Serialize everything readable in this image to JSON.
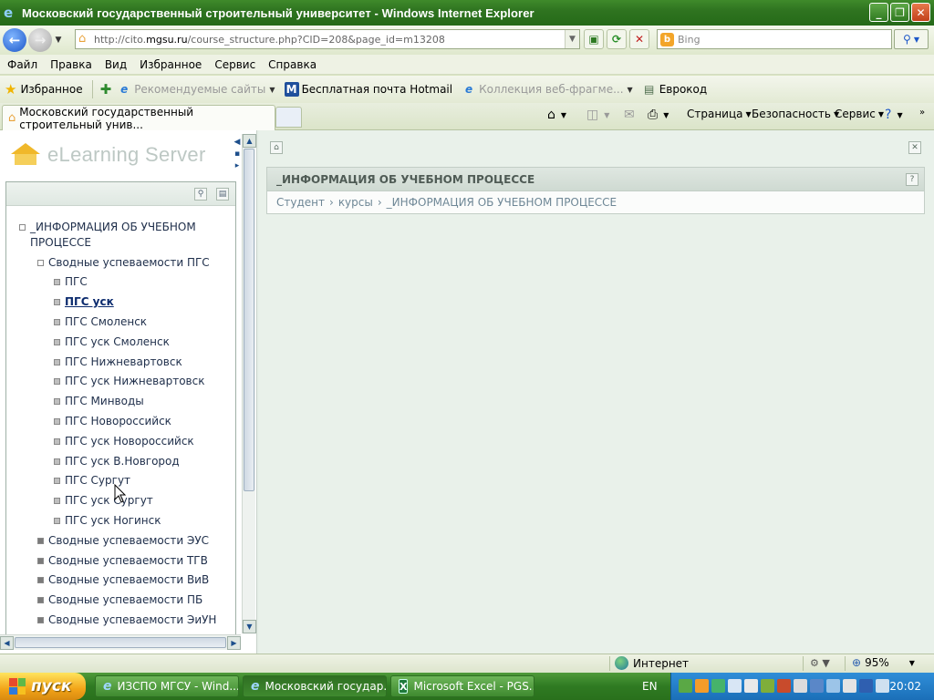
{
  "window": {
    "title": "Московский государственный строительный университет - Windows Internet Explorer",
    "buttons": {
      "minimize": "_",
      "restore": "❐",
      "close": "✕"
    }
  },
  "address": {
    "url_prefix": "http://cito.",
    "url_host": "mgsu.ru",
    "url_path": "/course_structure.php?CID=208&page_id=m13208",
    "search_placeholder": "Bing"
  },
  "menu": {
    "items": [
      "Файл",
      "Правка",
      "Вид",
      "Избранное",
      "Сервис",
      "Справка"
    ]
  },
  "favorites": {
    "label": "Избранное",
    "links": [
      {
        "label": "Рекомендуемые сайты",
        "icon": "ie-icon",
        "dim": true,
        "dropdown": true
      },
      {
        "label": "Бесплатная почта Hotmail",
        "icon": "msn-icon",
        "dim": false,
        "dropdown": false
      },
      {
        "label": "Коллекция веб-фрагме...",
        "icon": "ie-icon",
        "dim": true,
        "dropdown": true
      },
      {
        "label": "Еврокод",
        "icon": "page-icon",
        "dim": false,
        "dropdown": false
      }
    ]
  },
  "tabs": {
    "active_label": "Московский государственный строительный унив..."
  },
  "commandbar": {
    "page": "Страница",
    "safety": "Безопасность",
    "tools": "Сервис"
  },
  "app": {
    "logo_text": "eLearning Server"
  },
  "tree": {
    "root": "_ИНФОРМАЦИЯ ОБ УЧЕБНОМ ПРОЦЕССЕ",
    "root_line1": "_ИНФОРМАЦИЯ ОБ УЧЕБНОМ",
    "root_line2": "ПРОЦЕССЕ",
    "group_open": "Сводные успеваемости ПГС",
    "leaves": [
      "ПГС",
      "ПГС уск",
      "ПГС Смоленск",
      "ПГС уск Смоленск",
      "ПГС Нижневартовск",
      "ПГС уск Нижневартовск",
      "ПГС Минводы",
      "ПГС Новороссийск",
      "ПГС уск Новороссийск",
      "ПГС уск В.Новгород",
      "ПГС Сургут",
      "ПГС уск Сургут",
      "ПГС уск Ногинск"
    ],
    "selected_leaf": "ПГС уск",
    "groups_closed": [
      "Сводные успеваемости ЭУС",
      "Сводные успеваемости ТГВ",
      "Сводные успеваемости ВиВ",
      "Сводные успеваемости ПБ",
      "Сводные успеваемости ЭиУН"
    ]
  },
  "content": {
    "header": "_ИНФОРМАЦИЯ ОБ УЧЕБНОМ ПРОЦЕССЕ",
    "breadcrumb": [
      "Студент",
      "курсы",
      "_ИНФОРМАЦИЯ ОБ УЧЕБНОМ ПРОЦЕССЕ"
    ]
  },
  "status": {
    "zone": "Интернет",
    "zoom": "95%"
  },
  "taskbar": {
    "start": "пуск",
    "items": [
      {
        "label": "ИЗСПО МГСУ - Wind...",
        "icon": "ie"
      },
      {
        "label": "Московский государ...",
        "icon": "ie"
      },
      {
        "label": "Microsoft Excel - PGS...",
        "icon": "excel"
      }
    ],
    "lang": "EN",
    "clock": "20:02"
  },
  "colors": {
    "titlebar": "#2f7420",
    "tree_link": "#1e2e4a",
    "selected_link": "#0c2b6e",
    "breadcrumb": "#6e8796"
  }
}
